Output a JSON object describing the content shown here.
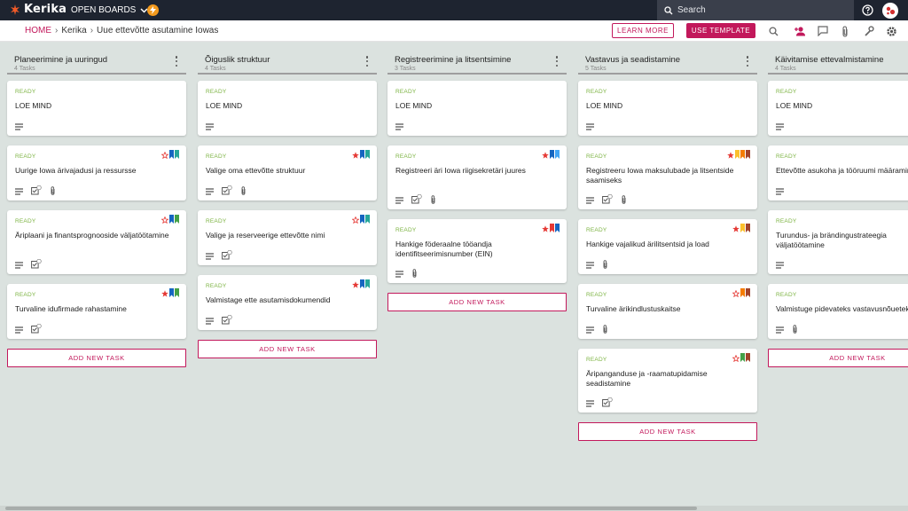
{
  "app": {
    "logo_text": "Kerika",
    "open_boards_label": "OPEN BOARDS",
    "search_placeholder": "Search"
  },
  "breadcrumb": {
    "home": "HOME",
    "items": [
      "Kerika",
      "Uue ettevõtte asutamine Iowas"
    ]
  },
  "toolbar": {
    "learn_more": "LEARN MORE",
    "use_template": "USE TEMPLATE",
    "icons": [
      "search-icon",
      "add-person-icon",
      "chat-icon",
      "attachment-icon",
      "wrench-icon",
      "settings-icon"
    ]
  },
  "colors": {
    "accent": "#c2185b",
    "ready": "#7cb342",
    "topbar": "#1e2430",
    "background": "#dbe2df"
  },
  "columns": [
    {
      "title": "Planeerimine ja uuringud",
      "count": "4 Tasks",
      "add_label": "ADD NEW TASK",
      "cards": [
        {
          "status": "READY",
          "title": "LOE MIND",
          "icons": [
            "description"
          ],
          "flags": []
        },
        {
          "status": "READY",
          "title": "Uurige Iowa ärivajadusi ja ressursse",
          "icons": [
            "description",
            "checklist",
            "attachment"
          ],
          "flags": [
            "star-outline",
            "blue",
            "teal"
          ]
        },
        {
          "status": "READY",
          "title": "Äriplaani ja finantsprognooside väljatöötamine",
          "icons": [
            "description",
            "checklist"
          ],
          "flags": [
            "star-outline",
            "blue",
            "green"
          ]
        },
        {
          "status": "READY",
          "title": "Turvaline idufirmade rahastamine",
          "icons": [
            "description",
            "checklist"
          ],
          "flags": [
            "star",
            "blue",
            "green"
          ]
        }
      ]
    },
    {
      "title": "Õiguslik struktuur",
      "count": "4 Tasks",
      "add_label": "ADD NEW TASK",
      "cards": [
        {
          "status": "READY",
          "title": "LOE MIND",
          "icons": [
            "description"
          ],
          "flags": []
        },
        {
          "status": "READY",
          "title": "Valige oma ettevõtte struktuur",
          "icons": [
            "description",
            "checklist",
            "attachment"
          ],
          "flags": [
            "star",
            "blue",
            "teal"
          ]
        },
        {
          "status": "READY",
          "title": "Valige ja reserveerige ettevõtte nimi",
          "icons": [
            "description",
            "checklist"
          ],
          "flags": [
            "star-outline",
            "blue",
            "teal"
          ]
        },
        {
          "status": "READY",
          "title": "Valmistage ette asutamisdokumendid",
          "icons": [
            "description",
            "checklist"
          ],
          "flags": [
            "star",
            "blue",
            "teal"
          ]
        }
      ]
    },
    {
      "title": "Registreerimine ja litsentsimine",
      "count": "3 Tasks",
      "add_label": "ADD NEW TASK",
      "cards": [
        {
          "status": "READY",
          "title": "LOE MIND",
          "icons": [
            "description"
          ],
          "flags": []
        },
        {
          "status": "READY",
          "title": "Registreeri äri Iowa riigisekretäri juures",
          "icons": [
            "description",
            "checklist",
            "attachment"
          ],
          "flags": [
            "star",
            "blue",
            "lightblue"
          ]
        },
        {
          "status": "READY",
          "title": "Hankige föderaalne tööandja identifitseerimisnumber (EIN)",
          "icons": [
            "description",
            "attachment"
          ],
          "flags": [
            "star",
            "red",
            "blue"
          ]
        }
      ]
    },
    {
      "title": "Vastavus ja seadistamine",
      "count": "5 Tasks",
      "add_label": "ADD NEW TASK",
      "cards": [
        {
          "status": "READY",
          "title": "LOE MIND",
          "icons": [
            "description"
          ],
          "flags": []
        },
        {
          "status": "READY",
          "title": "Registreeru Iowa maksulubade ja litsentside saamiseks",
          "icons": [
            "description",
            "checklist",
            "attachment"
          ],
          "flags": [
            "star",
            "yellow",
            "orange",
            "brown"
          ]
        },
        {
          "status": "READY",
          "title": "Hankige vajalikud ärilitsentsid ja load",
          "icons": [
            "description",
            "attachment"
          ],
          "flags": [
            "star",
            "yellow",
            "brown"
          ]
        },
        {
          "status": "READY",
          "title": "Turvaline ärikindlustuskaitse",
          "icons": [
            "description",
            "attachment"
          ],
          "flags": [
            "star-outline",
            "orange",
            "brown"
          ]
        },
        {
          "status": "READY",
          "title": "Äripanganduse ja -raamatupidamise seadistamine",
          "icons": [
            "description",
            "checklist"
          ],
          "flags": [
            "star-outline",
            "green",
            "brown"
          ]
        }
      ]
    },
    {
      "title": "Käivitamise ettevalmistamine",
      "count": "4 Tasks",
      "add_label": "ADD NEW TASK",
      "cards": [
        {
          "status": "READY",
          "title": "LOE MIND",
          "icons": [
            "description"
          ],
          "flags": []
        },
        {
          "status": "READY",
          "title": "Ettevõtte asukoha ja tööruumi määramine",
          "icons": [
            "description"
          ],
          "flags": []
        },
        {
          "status": "READY",
          "title": "Turundus- ja brändingustrateegia väljatöötamine",
          "icons": [
            "description"
          ],
          "flags": []
        },
        {
          "status": "READY",
          "title": "Valmistuge pidevateks vastavusnõueteks",
          "icons": [
            "description",
            "attachment"
          ],
          "flags": []
        }
      ]
    }
  ]
}
